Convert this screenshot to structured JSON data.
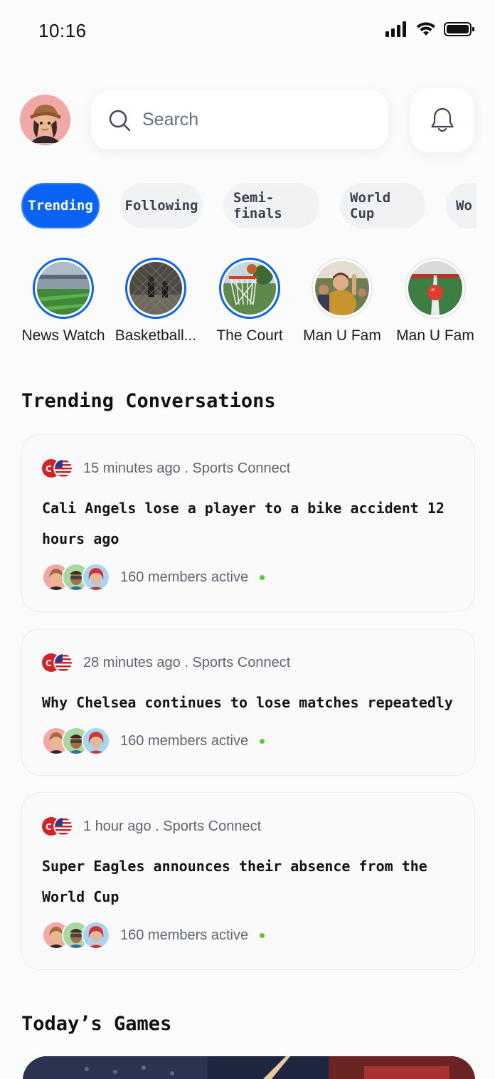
{
  "status_bar": {
    "time": "10:16"
  },
  "search": {
    "placeholder": "Search"
  },
  "chips": [
    "Trending",
    "Following",
    "Semi-finals",
    "World Cup",
    "Wo"
  ],
  "stories": [
    {
      "label": "News Watch"
    },
    {
      "label": "Basketball..."
    },
    {
      "label": "The Court"
    },
    {
      "label": "Man U Fam"
    },
    {
      "label": "Man U Fam"
    }
  ],
  "sections": {
    "trending_title": "Trending Conversations",
    "games_title": "Today’s Games"
  },
  "conversations": [
    {
      "meta": "15 minutes ago . Sports Connect",
      "headline": "Cali Angels lose a player to a bike accident 12 hours ago",
      "members": "160 members active"
    },
    {
      "meta": "28 minutes ago . Sports Connect",
      "headline": "Why Chelsea continues to lose matches repeatedly",
      "members": "160 members active"
    },
    {
      "meta": "1 hour ago . Sports Connect",
      "headline": "Super Eagles announces their absence from the World Cup",
      "members": "160 members active"
    }
  ],
  "colors": {
    "accent": "#0a63f5",
    "online": "#5cc63b"
  },
  "icons": [
    "signal-icon",
    "wifi-icon",
    "battery-icon",
    "search-icon",
    "bell-icon"
  ]
}
